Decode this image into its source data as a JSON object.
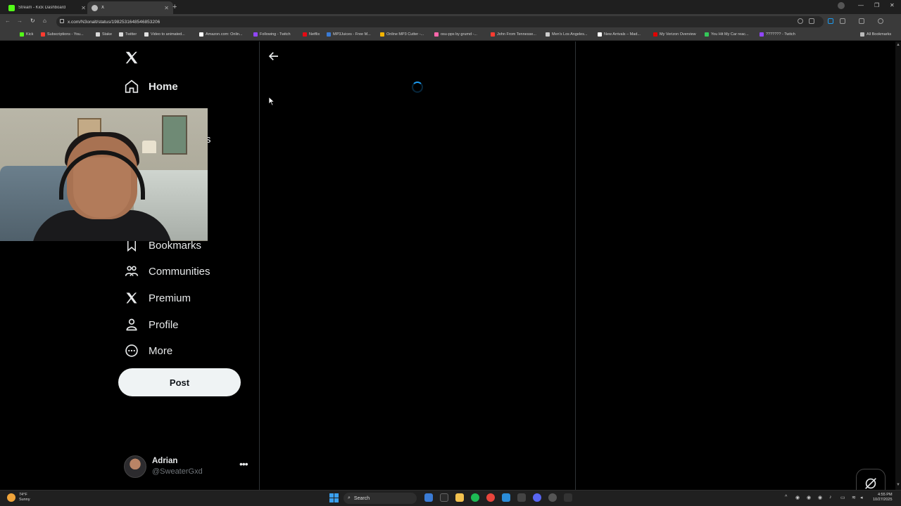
{
  "browser": {
    "tabs": [
      {
        "title": "Stream - Kick Dashboard",
        "active": false,
        "favicon_color": "#53fc18"
      },
      {
        "title": "X",
        "active": true,
        "favicon_color": "#bbbbbb"
      }
    ],
    "url": "x.com/N3onalt/status/1982531648546853206",
    "bookmarks": [
      {
        "label": "Kick",
        "color": "#53fc18"
      },
      {
        "label": "Subscriptions - You...",
        "color": "#ff3b30"
      },
      {
        "label": "Stake",
        "color": "#d8d8d8"
      },
      {
        "label": "Twitter",
        "color": "#d8d8d8"
      },
      {
        "label": "Video to animated...",
        "color": "#e0e0e0"
      },
      {
        "label": "Amazon.com: Onlin...",
        "color": "#ffffff"
      },
      {
        "label": "Following - Twitch",
        "color": "#9146ff"
      },
      {
        "label": "Netflix",
        "color": "#e50914"
      },
      {
        "label": "MP3Juices - Free M...",
        "color": "#3a7bd5"
      },
      {
        "label": "Online MP3 Cutter -...",
        "color": "#f4b400"
      },
      {
        "label": "osu-pps by grumd -...",
        "color": "#ff66aa"
      },
      {
        "label": "John From Tennesse...",
        "color": "#ff3b30"
      },
      {
        "label": "Men's Los Angeles...",
        "color": "#cccccc"
      },
      {
        "label": "New Arrivals – Mad...",
        "color": "#ffffff"
      },
      {
        "label": "My Verizon Overview",
        "color": "#e00000"
      },
      {
        "label": "You Hit My Car reac...",
        "color": "#34c759"
      },
      {
        "label": "??????? - Twitch",
        "color": "#9146ff"
      },
      {
        "label": "All Bookmarks",
        "color": "#bbbbbb"
      }
    ]
  },
  "sidebar": {
    "items": {
      "home": "Home",
      "bookmarks": "Bookmarks",
      "communities": "Communities",
      "premium": "Premium",
      "profile": "Profile",
      "more": "More"
    },
    "partial_label_fragment": "s",
    "post_label": "Post"
  },
  "account": {
    "name": "Adrian",
    "handle": "@SweaterGxd"
  },
  "main": {
    "loading": true,
    "accent_color": "#1d9bf0"
  },
  "taskbar": {
    "weather_temp": "74°F",
    "weather_cond": "Sunny",
    "search_label": "Search",
    "time": "4:55 PM",
    "date": "10/27/2025"
  }
}
